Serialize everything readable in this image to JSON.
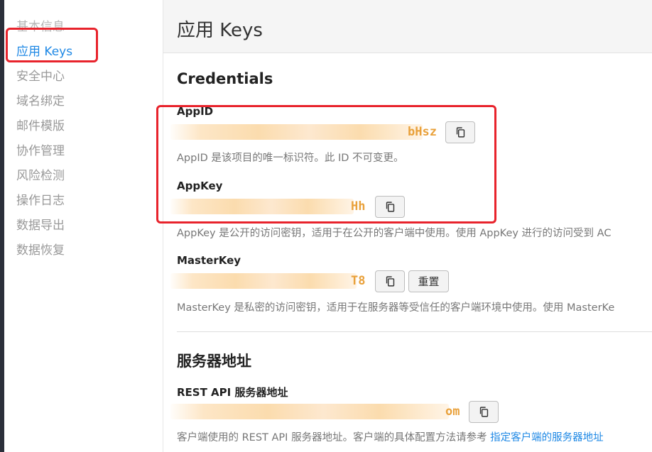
{
  "sidebar": {
    "items": [
      {
        "label": "基本信息"
      },
      {
        "label": "应用 Keys"
      },
      {
        "label": "安全中心"
      },
      {
        "label": "域名绑定"
      },
      {
        "label": "邮件模版"
      },
      {
        "label": "协作管理"
      },
      {
        "label": "风险检测"
      },
      {
        "label": "操作日志"
      },
      {
        "label": "数据导出"
      },
      {
        "label": "数据恢复"
      }
    ]
  },
  "header": {
    "title": "应用 Keys"
  },
  "credentials": {
    "title": "Credentials",
    "app_id": {
      "label": "AppID",
      "value_suffix": "bHsz",
      "description": "AppID 是该项目的唯一标识符。此 ID 不可变更。"
    },
    "app_key": {
      "label": "AppKey",
      "value_suffix": "Hh",
      "description": "AppKey 是公开的访问密钥，适用于在公开的客户端中使用。使用 AppKey 进行的访问受到 AC"
    },
    "master_key": {
      "label": "MasterKey",
      "value_suffix": "T8",
      "reset_label": "重置",
      "description": "MasterKey 是私密的访问密钥，适用于在服务器等受信任的客户端环境中使用。使用 MasterKe"
    }
  },
  "server": {
    "title": "服务器地址",
    "rest_api": {
      "label": "REST API 服务器地址",
      "value_suffix": "om",
      "description": "客户端使用的 REST API 服务器地址。客户端的具体配置方法请参考 ",
      "link_text": "指定客户端的服务器地址"
    }
  },
  "colors": {
    "accent": "#1e88e5",
    "value": "#e9a13b",
    "highlight": "#e8232c"
  },
  "icons": {
    "copy": "copy-icon"
  }
}
